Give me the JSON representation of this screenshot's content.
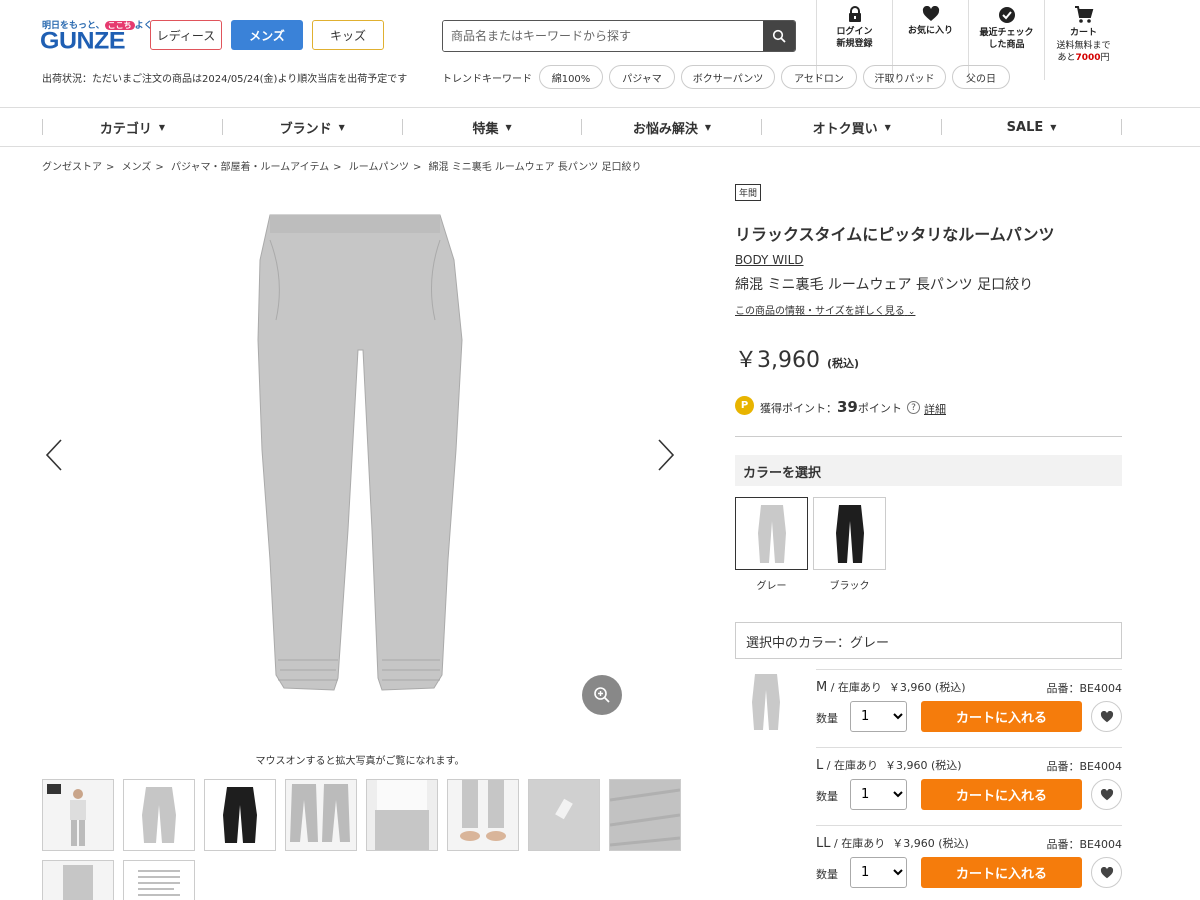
{
  "header": {
    "logo_tagline_pre": "明日をもっと、",
    "logo_tagline_hl": "ここち",
    "logo_tagline_post": "よく",
    "logo": "GUNZE",
    "gender_tabs": [
      "レディース",
      "メンズ",
      "キッズ"
    ],
    "search_placeholder": "商品名またはキーワードから探す",
    "login": [
      "ログイン",
      "新規登録"
    ],
    "favorites": "お気に入り",
    "recent": [
      "最近チェック",
      "した商品"
    ],
    "cart": "カート",
    "free_ship_1": "送料無料まで",
    "free_ship_2_pre": "あと",
    "free_ship_amount": "7000",
    "free_ship_2_post": "円",
    "shipping_status": "出荷状況：ただいまご注文の商品は2024/05/24(金)より順次当店を出荷予定です",
    "trend_label": "トレンドキーワード",
    "trend_keywords": [
      "綿100%",
      "パジャマ",
      "ボクサーパンツ",
      "アセドロン",
      "汗取りパッド",
      "父の日"
    ]
  },
  "nav": [
    "カテゴリ",
    "ブランド",
    "特集",
    "お悩み解決",
    "オトク買い",
    "SALE"
  ],
  "breadcrumb": [
    "グンゼストア",
    "メンズ",
    "パジャマ・部屋着・ルームアイテム",
    "ルームパンツ",
    "綿混 ミニ裏毛 ルームウェア 長パンツ 足口絞り"
  ],
  "gallery": {
    "hover_note": "マウスオンすると拡大写真がご覧になれます。"
  },
  "product": {
    "season_badge": "年間",
    "tagline": "リラックスタイムにピッタリなルームパンツ",
    "brand": "BODY WILD",
    "name": "綿混 ミニ裏毛 ルームウェア 長パンツ 足口絞り",
    "detail_link": "この商品の情報・サイズを詳しく見る",
    "price": "￥3,960",
    "tax_label": "(税込)",
    "points_label": "獲得ポイント：",
    "points_value": "39",
    "points_unit": "ポイント",
    "points_detail": "詳細"
  },
  "color_section": {
    "heading": "カラーを選択",
    "colors": [
      {
        "name": "グレー",
        "hex": "#c9c9c9"
      },
      {
        "name": "ブラック",
        "hex": "#1e1e1e"
      }
    ],
    "selected_label": "選択中のカラー：グレー"
  },
  "sizes": [
    {
      "size": "M",
      "stock": "在庫あり",
      "price": "￥3,960 (税込)",
      "sku": "品番：BE4004",
      "qty_label": "数量",
      "qty": "1",
      "cart": "カートに入れる"
    },
    {
      "size": "L",
      "stock": "在庫あり",
      "price": "￥3,960 (税込)",
      "sku": "品番：BE4004",
      "qty_label": "数量",
      "qty": "1",
      "cart": "カートに入れる"
    },
    {
      "size": "LL",
      "stock": "在庫あり",
      "price": "￥3,960 (税込)",
      "sku": "品番：BE4004",
      "qty_label": "数量",
      "qty": "1",
      "cart": "カートに入れる"
    }
  ]
}
